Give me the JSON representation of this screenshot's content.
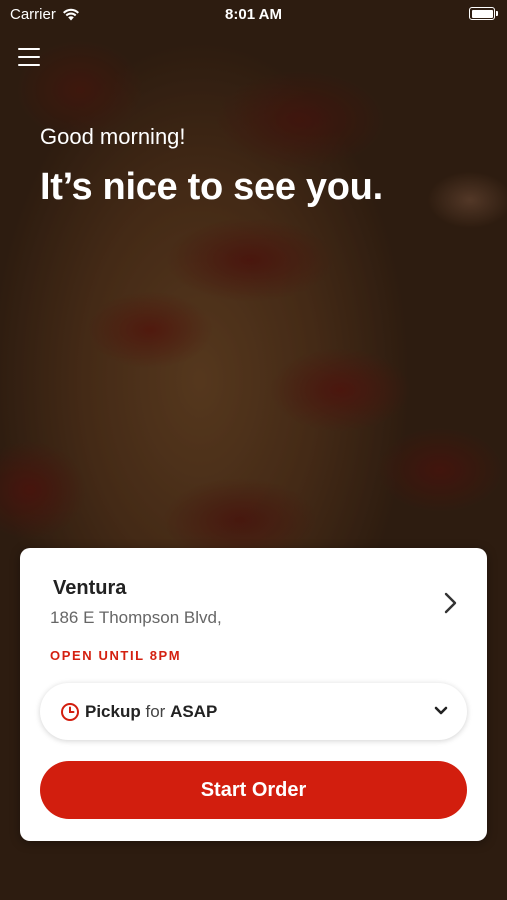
{
  "status_bar": {
    "carrier": "Carrier",
    "time": "8:01 AM",
    "battery_level": 1.0
  },
  "header": {
    "menu_icon": "hamburger-menu-icon",
    "greeting": "Good morning!",
    "headline": "It’s nice to see you."
  },
  "location_card": {
    "store_name": "Ventura",
    "address": "186 E Thompson Blvd,",
    "hours_status": "OPEN UNTIL 8PM",
    "chevron_icon": "chevron-right-icon",
    "order_mode": {
      "method": "Pickup",
      "connector": "for",
      "time": "ASAP",
      "icon": "clock-icon"
    },
    "start_button_label": "Start Order"
  },
  "colors": {
    "accent_red": "#d21e0e",
    "text_dark": "#222222",
    "text_muted": "#666666"
  }
}
